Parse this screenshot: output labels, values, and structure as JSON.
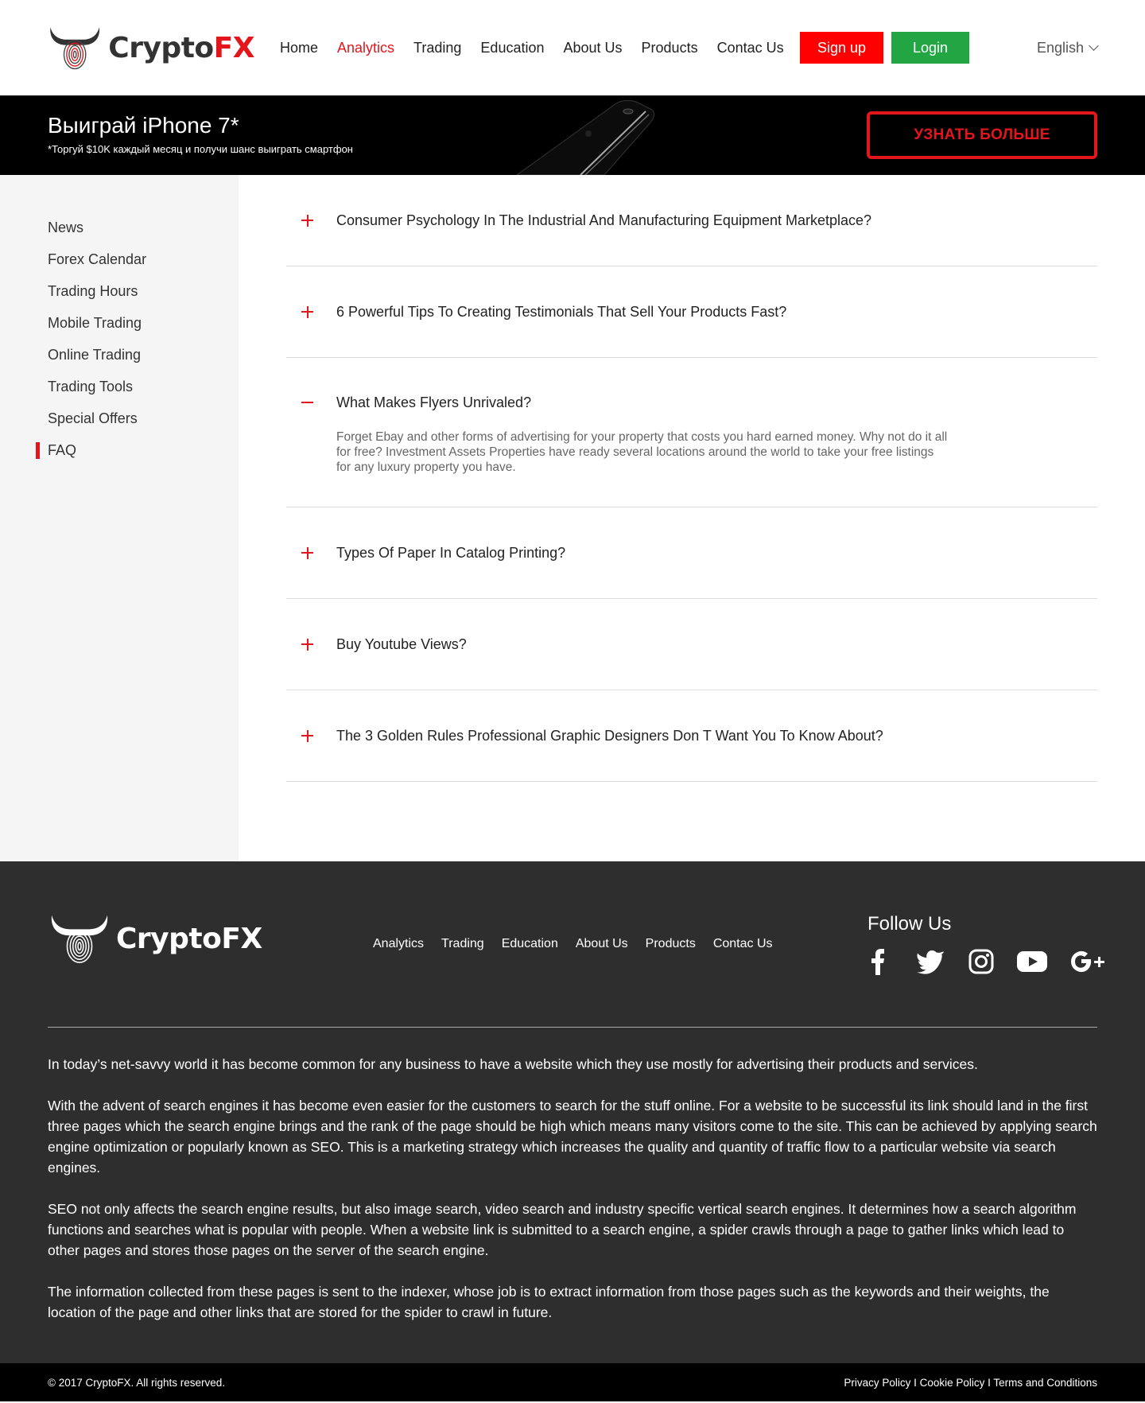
{
  "brand": {
    "name_a": "Crypto",
    "name_b": "FX"
  },
  "nav": {
    "items": [
      "Home",
      "Analytics",
      "Trading",
      "Education",
      "About Us",
      "Products",
      "Contac Us"
    ],
    "active": "Analytics",
    "signup": "Sign up",
    "login": "Login",
    "language": "English"
  },
  "banner": {
    "title": "Выиграй iPhone 7*",
    "subtitle": "*Торгуй $10K каждый месяц и получи шанс выиграть смартфон",
    "cta": "УЗНАТЬ БОЛЬШЕ"
  },
  "sidebar": {
    "items": [
      "News",
      "Forex Calendar",
      "Trading Hours",
      "Mobile Trading",
      "Online Trading",
      "Trading Tools",
      "Special Offers",
      "FAQ"
    ],
    "active": "FAQ"
  },
  "faq": [
    {
      "q": "Consumer Psychology In The Industrial And Manufacturing Equipment Marketplace?",
      "open": false
    },
    {
      "q": "6 Powerful Tips To Creating Testimonials That Sell Your Products Fast?",
      "open": false
    },
    {
      "q": "What Makes Flyers Unrivaled?",
      "open": true,
      "a": "Forget Ebay and other forms of advertising for your property that costs you hard earned money. Why not do it all for free? Investment Assets Properties have ready several locations around the world to take your free listings for any luxury property you have."
    },
    {
      "q": "Types Of Paper In Catalog Printing?",
      "open": false
    },
    {
      "q": "Buy Youtube Views?",
      "open": false
    },
    {
      "q": "The 3 Golden Rules Professional Graphic Designers Don T Want You To Know About?",
      "open": false
    }
  ],
  "footer": {
    "nav": [
      "Analytics",
      "Trading",
      "Education",
      "About Us",
      "Products",
      "Contac Us"
    ],
    "follow_title": "Follow Us",
    "socials": [
      "facebook-icon",
      "twitter-icon",
      "instagram-icon",
      "youtube-icon",
      "google-plus-icon"
    ],
    "paragraphs": [
      "In today’s net-savvy world it has become common for any business to have a website which they use mostly for advertising their products and services.",
      "With the advent of search engines it has become even easier for the customers to search for the stuff online. For a website to be successful its link should land in the first three pages which the search engine brings and the rank of the page should be high which means many visitors come to the site. This can be achieved by applying search engine optimization or popularly known as SEO. This is a marketing strategy which increases the quality and quantity of traffic flow to a particular website via search engines.",
      "SEO not only affects the search engine results, but also image search, video search and industry specific vertical search engines. It determines how a search algorithm functions and searches what is popular with people. When a website link is submitted to a search engine, a spider crawls through a page to gather links which lead to other pages and stores those pages on the server of the search engine.",
      "The information collected from these pages is sent to the indexer, whose job is to extract information from those pages such as the keywords and their weights, the location of the page and other links that are stored for the spider to crawl in future."
    ],
    "copyright": "© 2017 CryptoFX. All rights reserved.",
    "legal": "Privacy Policy I Cookie Policy I Terms and Conditions"
  },
  "colors": {
    "accent": "#e3161b",
    "green": "#22a643",
    "footer_bg": "#2e2e2e"
  }
}
